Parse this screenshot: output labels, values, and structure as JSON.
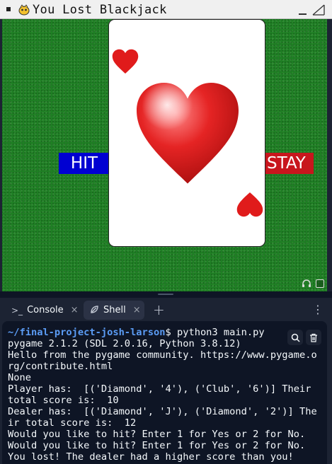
{
  "window": {
    "title": "You Lost Blackjack",
    "icons": [
      "window-menu-icon",
      "pygame-logo-icon",
      "minimize-icon",
      "maximize-icon"
    ]
  },
  "game": {
    "hit_label": "HIT",
    "stay_label": "STAY",
    "card": {
      "suit": "heart",
      "color": "#e01b1b"
    },
    "colors": {
      "felt": "#1f7f24",
      "hit": "#0000d2",
      "stay": "#c8161d"
    },
    "status_icons": [
      "headphones-icon",
      "square-icon"
    ]
  },
  "tabs": [
    {
      "label": "Console",
      "icon": "terminal-icon",
      "active": false
    },
    {
      "label": "Shell",
      "icon": "shell-icon",
      "active": true
    }
  ],
  "shell": {
    "prompt_path": "~/final-project-josh-larson",
    "command": "$ python3 main.py",
    "lines": [
      "pygame 2.1.2 (SDL 2.0.16, Python 3.8.12)",
      "Hello from the pygame community. https://www.pygame.org/contribute.html",
      "None",
      "Player has:  [('Diamond', '4'), ('Club', '6')] Their total score is:  10",
      "Dealer has:  [('Diamond', 'J'), ('Diamond', '2')] The ir total score is:  12",
      "Would you like to hit? Enter 1 for Yes or 2 for No.",
      "Would you like to hit? Enter 1 for Yes or 2 for No.",
      "You lost! The dealer had a higher score than you!"
    ],
    "tools": [
      "search-icon",
      "trash-icon"
    ]
  }
}
